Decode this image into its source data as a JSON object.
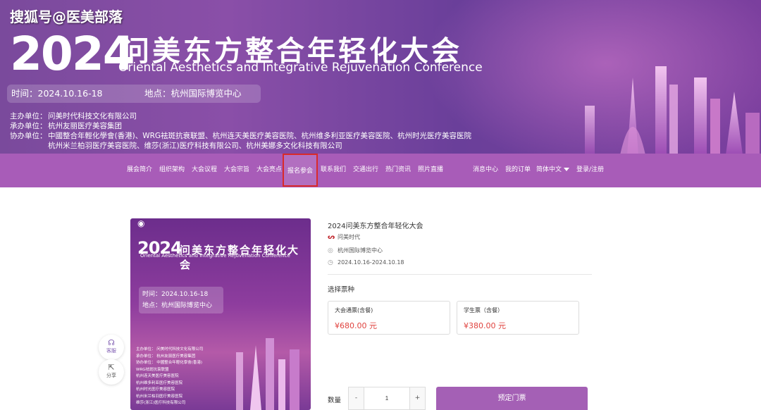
{
  "watermark": "搜狐号@医美部落",
  "banner": {
    "year": "2024",
    "title_cn": "问美东方整合年轻化大会",
    "title_en": "Oriental Aesthetics and Integrative Rejuvenation Conference",
    "time": "时间：2024.10.16-18",
    "location": "地点：杭州国际博览中心",
    "organizers": [
      {
        "key": "主办单位：",
        "value": "问美时代科技文化有限公司"
      },
      {
        "key": "承办单位：",
        "value": "杭州友丽医疗美容集团"
      },
      {
        "key": "协办单位：",
        "value": "中國整合年輕化學會(香港)、WRG祛斑抗衰联盟、杭州连天美医疗美容医院、杭州维多利亚医疗美容医院、杭州时光医疗美容医院"
      },
      {
        "key": "",
        "value": "杭州米兰柏羽医疗美容医院、维莎(浙江)医疗科技有限公司、杭州美娜多文化科技有限公司"
      }
    ]
  },
  "nav": {
    "items": [
      "展会简介",
      "组织架构",
      "大会议程",
      "大会宗旨",
      "大会亮点",
      "报名参会",
      "联系我们",
      "交通出行",
      "热门资讯",
      "照片直播"
    ],
    "right": [
      "消息中心",
      "我的订单",
      "简体中文",
      "登录/注册"
    ],
    "active_index": 5
  },
  "poster": {
    "year": "2024",
    "title": "问美东方整合年轻化大会",
    "title_en": "Oriental Aesthetics and Integrative Rejuvenation Conference",
    "time": "时间：2024.10.16-18",
    "location": "地点：杭州国际博览中心",
    "org_lines": [
      "主办单位： 问美时代科技文化有限公司",
      "承办单位： 杭州友丽医疗美容集团",
      "协办单位： 中國整合年輕化學會(香港)",
      "               WRG祛斑抗衰联盟",
      "               杭州连天美医疗美容医院",
      "               杭州维多利亚医疗美容医院",
      "               杭州时光医疗美容医院",
      "               杭州米兰柏羽医疗美容医院",
      "               维莎(浙江)医疗科技有限公司"
    ]
  },
  "float": {
    "service": "客服",
    "share": "分享"
  },
  "event": {
    "title": "2024问美东方整合年轻化大会",
    "organizer": "问美时代",
    "venue": "杭州国际博览中心",
    "dates": "2024.10.16-2024.10.18"
  },
  "tickets": {
    "label": "选择票种",
    "items": [
      {
        "name": "大会通票(含餐)",
        "price": "¥680.00 元"
      },
      {
        "name": "学生票（含餐）",
        "price": "¥380.00 元"
      }
    ]
  },
  "order": {
    "qty_label": "数量",
    "minus": "-",
    "plus": "+",
    "qty": "1",
    "book": "预定门票"
  },
  "colors": {
    "nav": "#a85cb8",
    "accent": "#a460b5",
    "price": "#e0433f",
    "active_outline": "#d92a2a"
  }
}
